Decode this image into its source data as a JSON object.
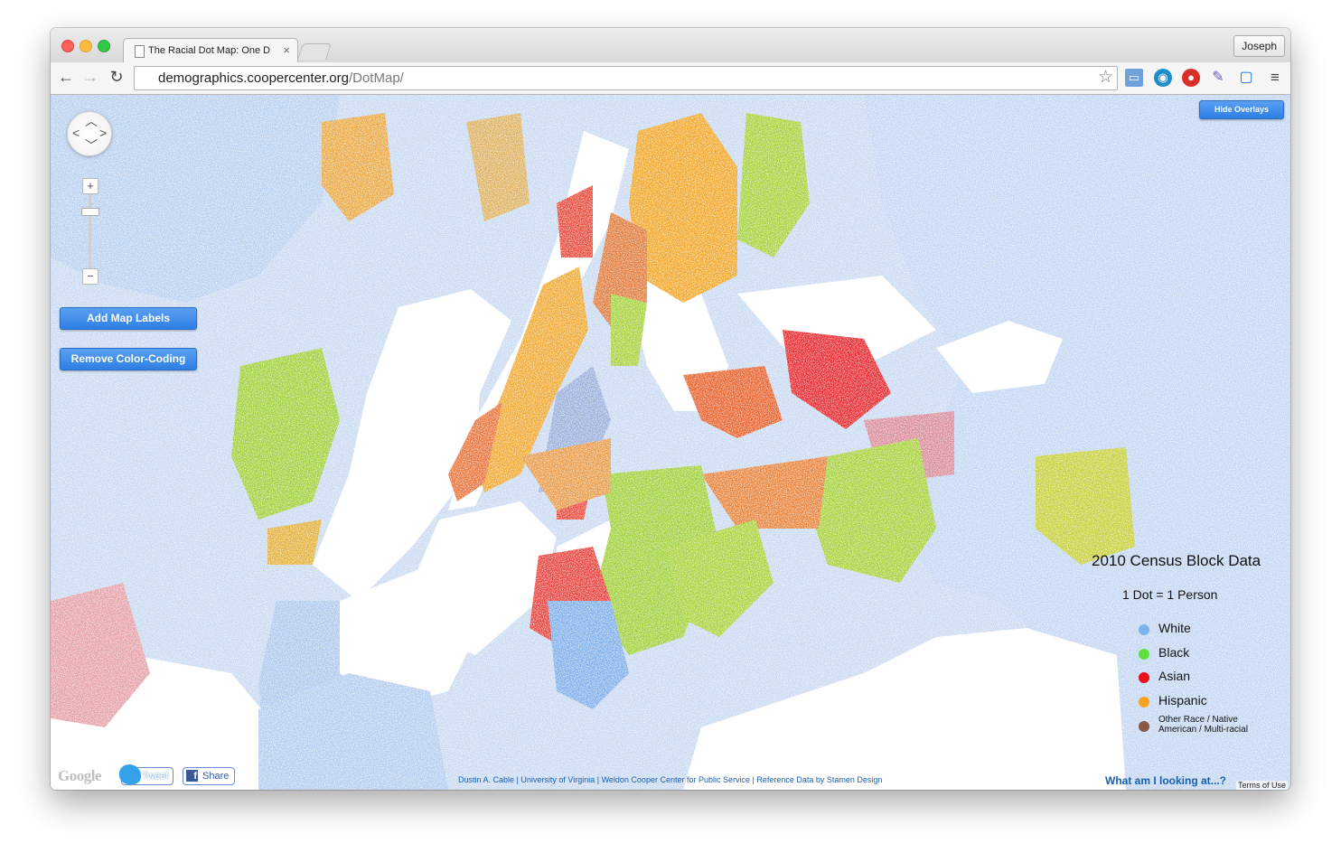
{
  "browser": {
    "tab_title": "The Racial Dot Map: One D",
    "tab_close": "×",
    "profile_name": "Joseph",
    "url_host": "demographics.coopercenter.org",
    "url_path": "/DotMap/",
    "back_icon": "←",
    "forward_icon": "→",
    "reload_icon": "↻",
    "star_icon": "☆",
    "menu_icon": "≡"
  },
  "map": {
    "buttons": {
      "add_labels": "Add Map Labels",
      "remove_color": "Remove Color-Coding",
      "hide_overlays": "Hide Overlays"
    },
    "zoom": {
      "in": "+",
      "out": "−"
    },
    "legend": {
      "title": "2010 Census Block Data",
      "subtitle": "1 Dot = 1 Person",
      "entries": [
        {
          "label": "White",
          "color": "#7eb2ec"
        },
        {
          "label": "Black",
          "color": "#5be03f"
        },
        {
          "label": "Asian",
          "color": "#e8101b"
        },
        {
          "label": "Hispanic",
          "color": "#f7a51e"
        },
        {
          "label": "Other Race / Native American / Multi-racial",
          "color": "#8a5a44"
        }
      ]
    },
    "info_link": "What am I looking at...?",
    "share": {
      "tweet": "Tweet",
      "facebook": "Share"
    },
    "google_logo": "Google",
    "credits": "Dustin A. Cable | University of Virginia | Weldon Cooper Center for Public Service | Reference Data by Stamen Design",
    "terms": "Terms of Use"
  }
}
